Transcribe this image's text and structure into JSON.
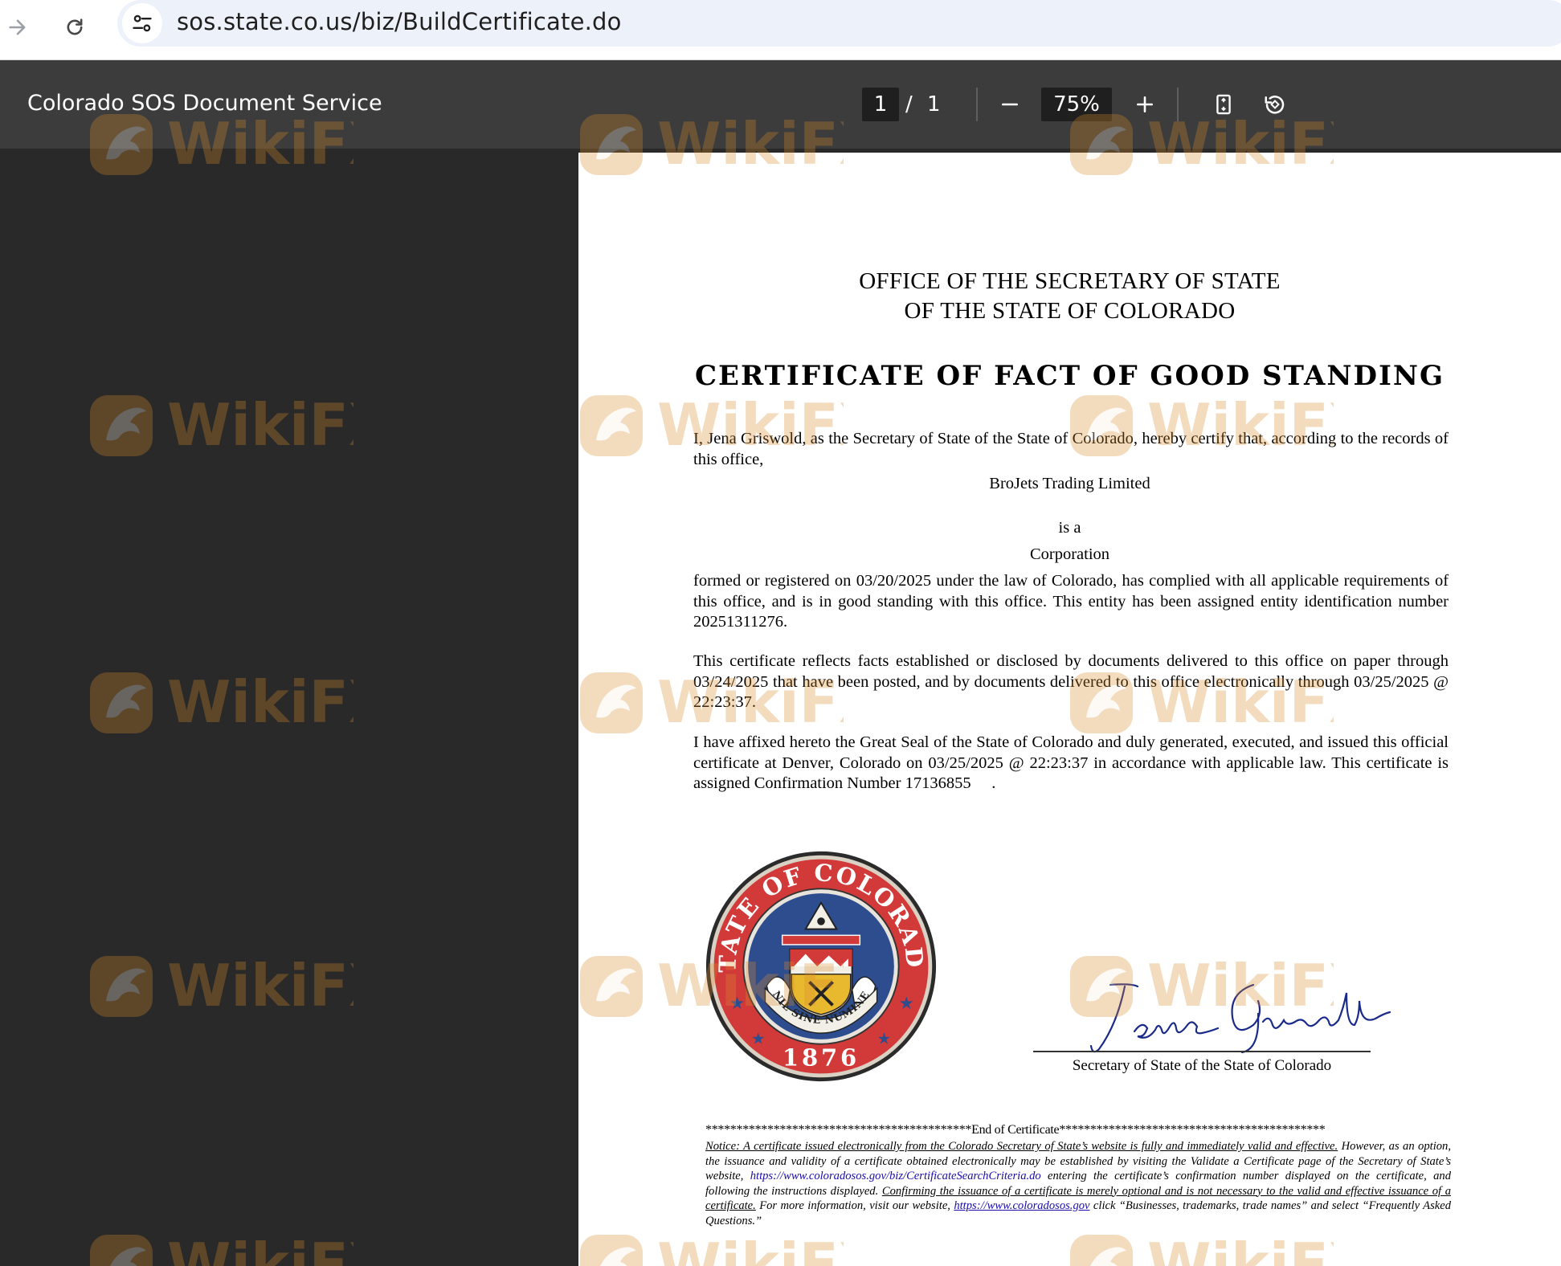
{
  "browser": {
    "url": "sos.state.co.us/biz/BuildCertificate.do"
  },
  "toolbar": {
    "title": "Colorado SOS Document Service",
    "page_current": "1",
    "page_separator": "/",
    "page_total": "1",
    "zoom": "75%"
  },
  "icons": {
    "forward": "arrow-right-icon",
    "reload": "reload-icon",
    "site_info": "tune-icon",
    "zoom_out": "minus-icon",
    "zoom_in": "plus-icon",
    "fit": "fit-page-icon",
    "rotate": "rotate-icon"
  },
  "watermark": {
    "text": "WikiFX",
    "color": "#d98a2b"
  },
  "certificate": {
    "office_line1": "OFFICE OF THE SECRETARY OF STATE",
    "office_line2": "OF THE STATE OF COLORADO",
    "title": "CERTIFICATE OF FACT OF GOOD STANDING",
    "intro": "I, Jena Griswold, as the Secretary of State of the State of Colorado, hereby certify that, according to the records of this office,",
    "entity_name": "BroJets Trading Limited",
    "is_a": "is a",
    "entity_type": "Corporation",
    "formed_p1": "formed or registered on",
    "formed_date": "03/20/2025",
    "formed_p2": "under the law of Colorado, has complied with all applicable requirements of this office, and is in good standing with this office.  This entity has been assigned entity identification number",
    "entity_id": "20251311276",
    "facts_p1": "This certificate reflects facts established or disclosed by documents delivered to this office on paper through",
    "paper_date": "03/24/2025",
    "facts_p2": "that have been posted, and by documents delivered to this office electronically through",
    "elec_date": "03/25/2025",
    "elec_at": "@",
    "elec_time": "22:23:37",
    "affixed_p1": "I have affixed hereto the Great Seal of the State of Colorado and duly generated, executed, and issued this official certificate at Denver, Colorado on",
    "issue_date": "03/25/2025",
    "issue_at": "@",
    "issue_time": "22:23:37",
    "affixed_p2": "in accordance with applicable law. This certificate is assigned Confirmation Number",
    "confirmation": "17136855",
    "seal": {
      "ring_top": "STATE OF COLORADO",
      "motto": "NIL SINE NUMINE",
      "year": "1876"
    },
    "signature_name": "Jena Griswold",
    "signature_caption": "Secretary of State of the State of Colorado",
    "end_marker": "*******************************************End of Certificate*******************************************",
    "notice_s1": "Notice: A certificate issued electronically from the Colorado Secretary of State’s website is fully and immediately valid and effective.",
    "notice_s2": "However, as an option, the issuance and validity of a certificate obtained electronically may be established by visiting the Validate a Certificate page of the Secretary of State’s website,",
    "notice_link1": "https://www.coloradosos.gov/biz/CertificateSearchCriteria.do",
    "notice_s3": "entering the certificate’s confirmation number displayed on the certificate, and following the instructions displayed.",
    "notice_s4": "Confirming the issuance of a certificate is merely optional and is not necessary to the valid and effective issuance of a certificate.",
    "notice_s5": "For more information, visit our website,",
    "notice_link2": "https://www.coloradosos.gov",
    "notice_s6": "click “Businesses, trademarks, trade names” and select “Frequently Asked Questions.”"
  }
}
